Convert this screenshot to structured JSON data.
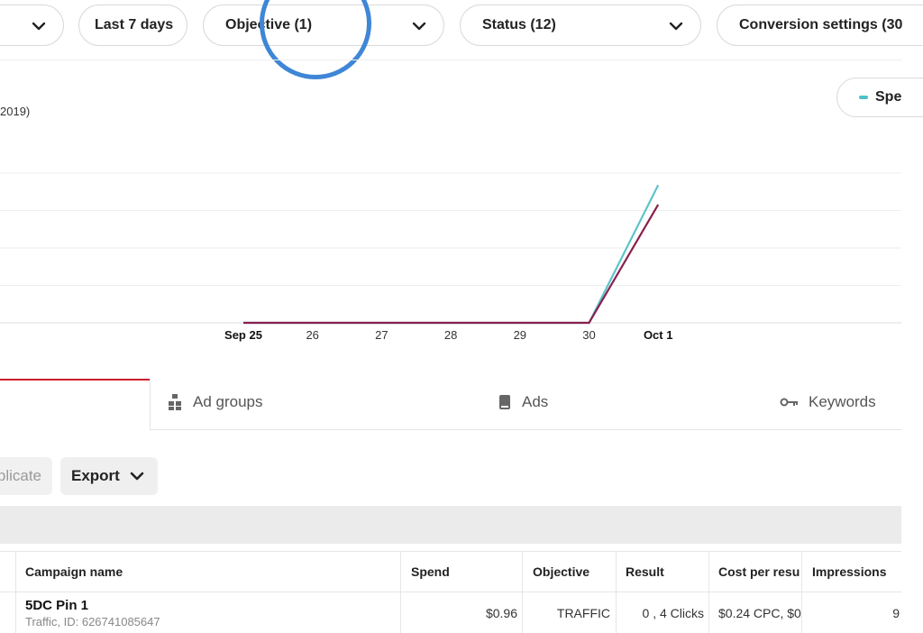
{
  "filters": {
    "first_pill": "",
    "date_range": "Last 7 days",
    "objective": "Objective (1)",
    "status": "Status (12)",
    "conversion": "Conversion settings (30"
  },
  "date_fragment": "2019)",
  "legend": {
    "label": "Spe",
    "color": "#4fc1c8"
  },
  "chart_data": {
    "type": "line",
    "x": [
      "Sep 25",
      "26",
      "27",
      "28",
      "29",
      "30",
      "Oct 1"
    ],
    "bold_ticks": [
      "Sep 25",
      "Oct 1"
    ],
    "series": [
      {
        "name": "",
        "color": "#5ec3c9",
        "values": [
          0,
          0,
          0,
          0,
          0,
          0,
          0.92
        ]
      },
      {
        "name": "",
        "color": "#8a1f4e",
        "values": [
          0,
          0,
          0,
          0,
          0,
          0,
          0.79
        ]
      }
    ],
    "ylim": [
      0,
      1
    ],
    "grid": true
  },
  "tabs": [
    {
      "label": "Ad groups",
      "icon": "ad-groups-icon"
    },
    {
      "label": "Ads",
      "icon": "ads-icon"
    },
    {
      "label": "Keywords",
      "icon": "key-icon"
    }
  ],
  "actions": {
    "duplicate": "plicate",
    "export": "Export"
  },
  "table": {
    "headers": {
      "campaign": "Campaign name",
      "spend": "Spend",
      "objective": "Objective",
      "result": "Result",
      "cost": "Cost per resu",
      "impressions": "Impressions"
    },
    "row": {
      "name": "5DC Pin 1",
      "sub": "Traffic, ID: 626741085647",
      "spend": "$0.96",
      "objective": "TRAFFIC",
      "result": "0 , 4 Clicks",
      "cost": "$0.24 CPC, $0",
      "impressions": "9"
    }
  }
}
